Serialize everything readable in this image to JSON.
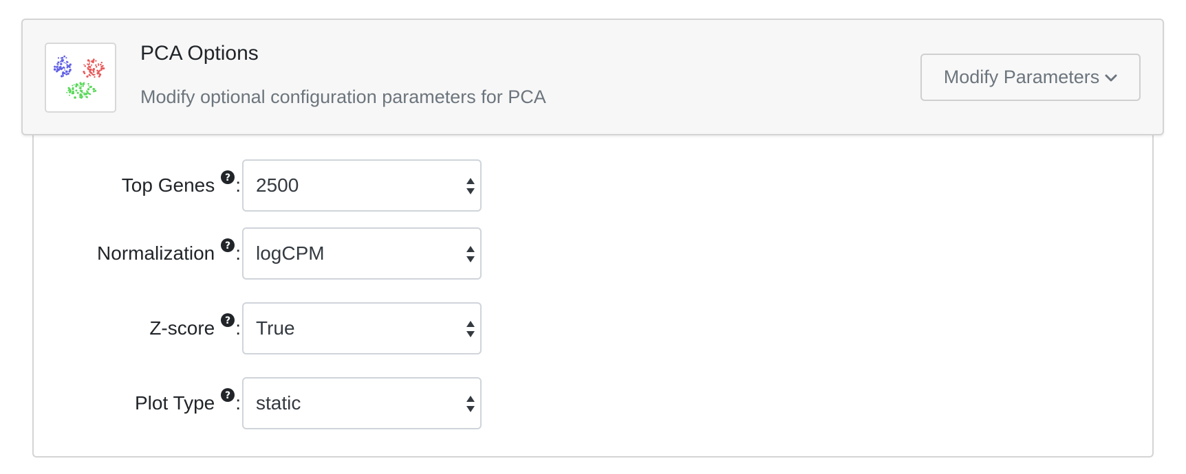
{
  "header": {
    "thumbnail_icon": "pca-scatter-thumbnail-icon",
    "title": "PCA Options",
    "subtitle": "Modify optional configuration parameters for PCA",
    "modify_button_label": "Modify Parameters",
    "modify_button_icon": "chevron-down-icon"
  },
  "form": {
    "fields": [
      {
        "label": "Top Genes",
        "help_icon": "question-circle-icon",
        "colon": ":",
        "value": "2500"
      },
      {
        "label": "Normalization",
        "help_icon": "question-circle-icon",
        "colon": ":",
        "value": "logCPM"
      },
      {
        "label": "Z-score",
        "help_icon": "question-circle-icon",
        "colon": ":",
        "value": "True"
      },
      {
        "label": "Plot Type",
        "help_icon": "question-circle-icon",
        "colon": ":",
        "value": "static"
      }
    ]
  },
  "colors": {
    "header_bg": "#f7f7f7",
    "border": "#d4d4d4",
    "muted_text": "#6c757d",
    "cluster_blue": "#2b2bdb",
    "cluster_red": "#e02424",
    "cluster_green": "#22cc22"
  }
}
